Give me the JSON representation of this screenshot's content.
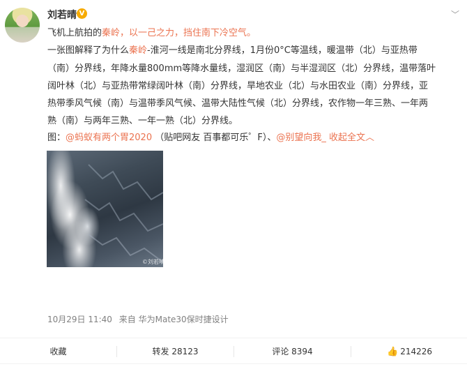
{
  "user": {
    "name": "刘若晴",
    "badge_icon": "vip-badge-icon"
  },
  "post": {
    "line1_a": "飞机上航拍的",
    "line1_b": "秦岭",
    "line1_c": "，以一己之力，挡住南下冷空气。",
    "line2_a": "一张图解释了为什么",
    "line2_b": "秦岭",
    "line2_c": "-淮河一线是南北分界线，1月份0°C等温线，暖温带（北）与亚热带",
    "line3": "（南）分界线，年降水量800mm等降水量线，湿润区（南）与半湿润区（北）分界线，温带落叶",
    "line4": "阔叶林（北）与亚热带常绿阔叶林（南）分界线，旱地农业（北）与水田农业（南）分界线，亚",
    "line5": "热带季风气候（南）与温带季风气候、温带大陆性气候（北）分界线，农作物一年三熟、一年两",
    "line6": "熟（南）与两年三熟、一年一熟（北）分界线。",
    "credit_prefix": "图：",
    "credit_link1": "@蚂蚁有两个胃2020",
    "credit_middle": " （贴吧网友 百事都可乐゜F）、",
    "credit_link2": "@别望向我_",
    "collapse_label": "收起全文",
    "collapse_icon": "chevron-up-icon",
    "watermark": "©刘若晴"
  },
  "meta": {
    "time": "10月29日 11:40",
    "from_label": "来自",
    "device": "华为Mate30保时捷设计"
  },
  "actions": {
    "favorite": "收藏",
    "repost": "转发 28123",
    "comment": "评论 8394",
    "like": "214226",
    "like_icon": "thumbs-up-icon"
  }
}
